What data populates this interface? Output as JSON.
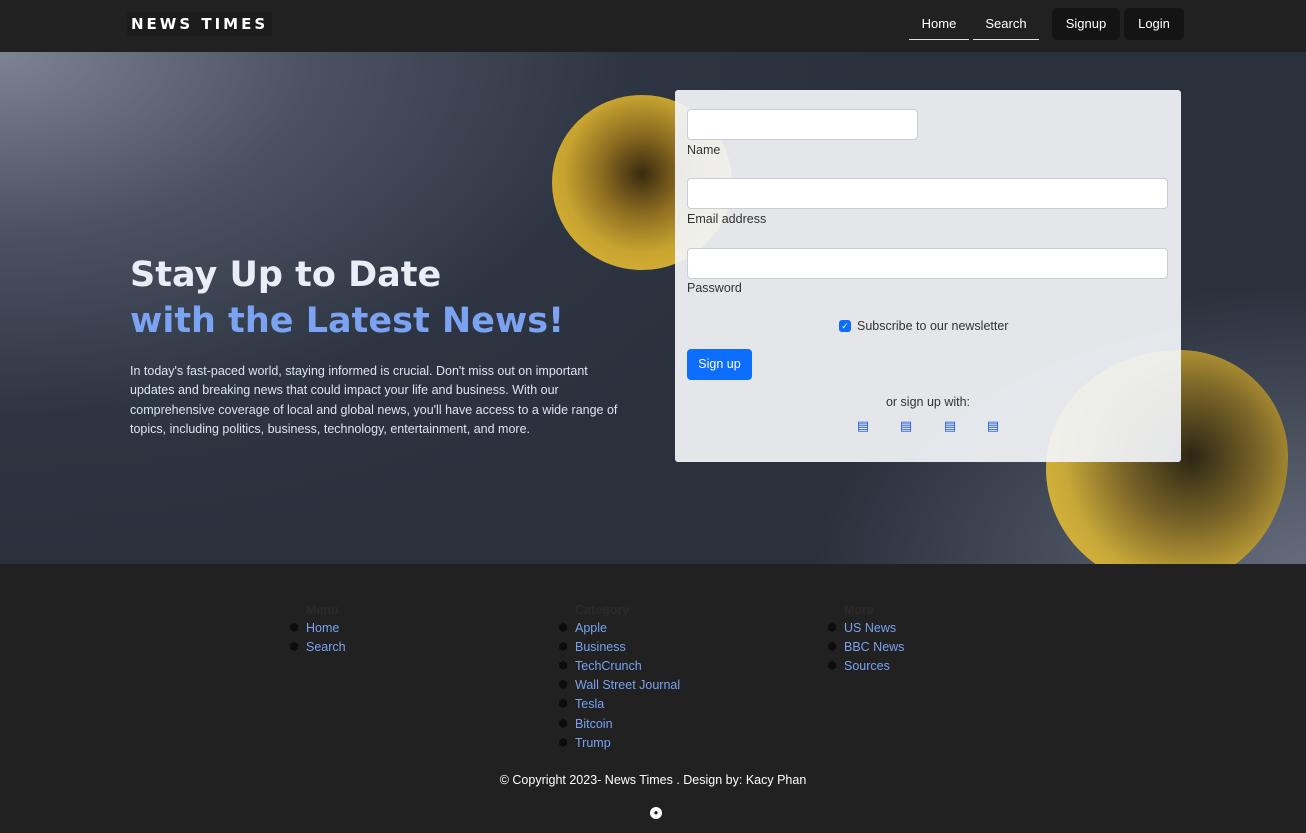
{
  "brand": "NEWS TIMES",
  "nav": {
    "home": "Home",
    "search": "Search",
    "signup": "Signup",
    "login": "Login"
  },
  "hero": {
    "title_line1": "Stay Up to Date",
    "title_line2": "with the Latest News!",
    "description": "In today's fast-paced world, staying informed is crucial. Don't miss out on important updates and breaking news that could impact your life and business. With our comprehensive coverage of local and global news, you'll have access to a wide range of topics, including politics, business, technology, entertainment, and more."
  },
  "form": {
    "name_label": "Name",
    "name_value": "",
    "email_label": "Email address",
    "email_value": "",
    "password_label": "Password",
    "password_value": "",
    "newsletter_label": "Subscribe to our newsletter",
    "newsletter_checked": true,
    "submit_label": "Sign up",
    "social_text": "or sign up with:",
    "social_icons": [
      "social-icon-1",
      "social-icon-2",
      "social-icon-3",
      "social-icon-4"
    ]
  },
  "footer": {
    "columns": [
      {
        "heading": "Menu",
        "links": [
          "Home",
          "Search"
        ]
      },
      {
        "heading": "Category",
        "links": [
          "Apple",
          "Business",
          "TechCrunch",
          "Wall Street Journal",
          "Tesla",
          "Bitcoin",
          "Trump"
        ]
      },
      {
        "heading": "More",
        "links": [
          "US News",
          "BBC News",
          "Sources"
        ]
      }
    ],
    "link_icon": "box-icon",
    "copyright": "© Copyright 2023- News Times . Design by: Kacy Phan",
    "social_icon": "github-icon"
  },
  "colors": {
    "accent_blue": "#0d6efd",
    "title_blue": "#7ba3f2",
    "blob_gold": "#e0bc3c",
    "navbar_bg": "#212121"
  }
}
